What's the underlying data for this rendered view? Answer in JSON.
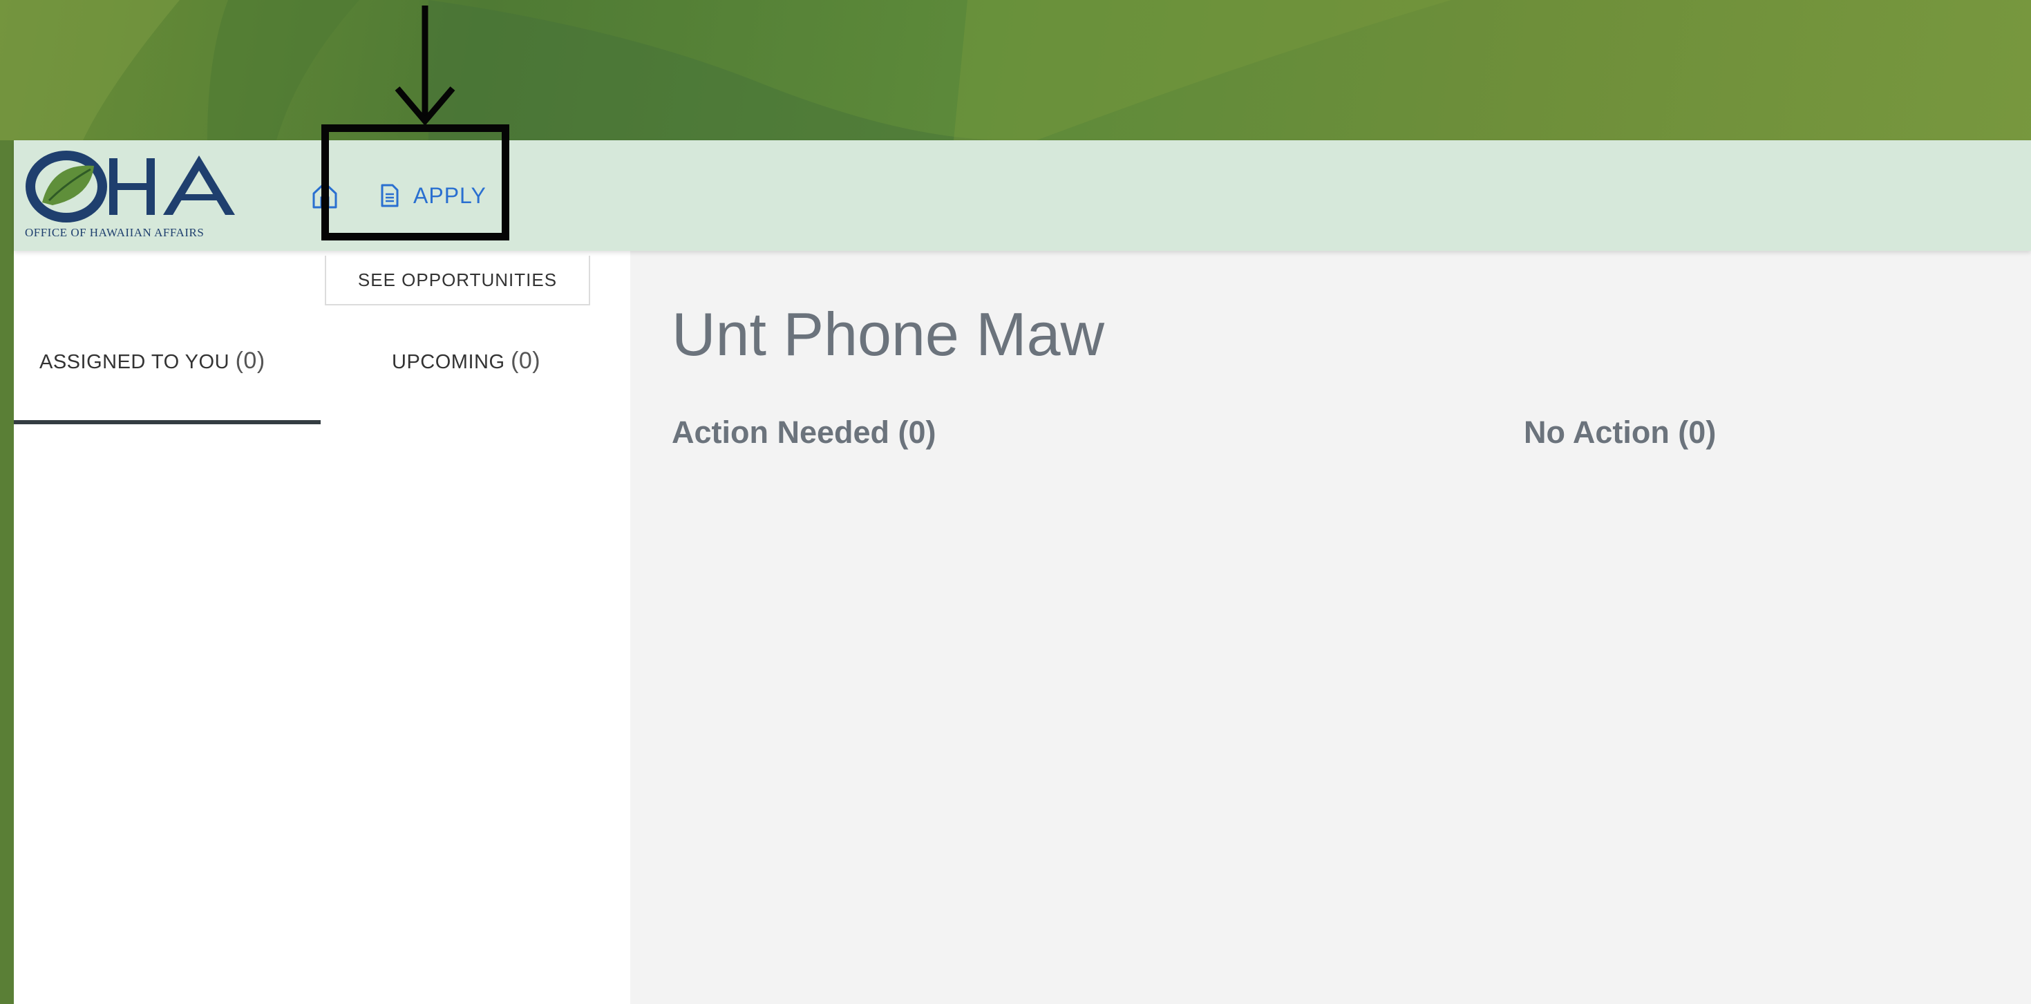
{
  "logo": {
    "initials": "OHA",
    "caption": "OFFICE OF HAWAIIAN AFFAIRS"
  },
  "nav": {
    "home_icon": "home-icon",
    "apply_icon": "document-icon",
    "apply_label": "APPLY"
  },
  "sidebar": {
    "see_opportunities_label": "SEE OPPORTUNITIES",
    "tabs": [
      {
        "label": "ASSIGNED TO YOU",
        "count": "(0)",
        "active": true
      },
      {
        "label": "UPCOMING",
        "count": "(0)",
        "active": false
      }
    ]
  },
  "main": {
    "title": "Unt Phone Maw",
    "sections": [
      {
        "label": "Action Needed (0)"
      },
      {
        "label": "No Action (0)"
      }
    ]
  },
  "colors": {
    "topbar_bg": "#d6e8da",
    "link_blue": "#2a6fd0",
    "logo_navy": "#1f3f6e",
    "heading_gray": "#6b737c",
    "background_green": "#5d8a3a"
  }
}
